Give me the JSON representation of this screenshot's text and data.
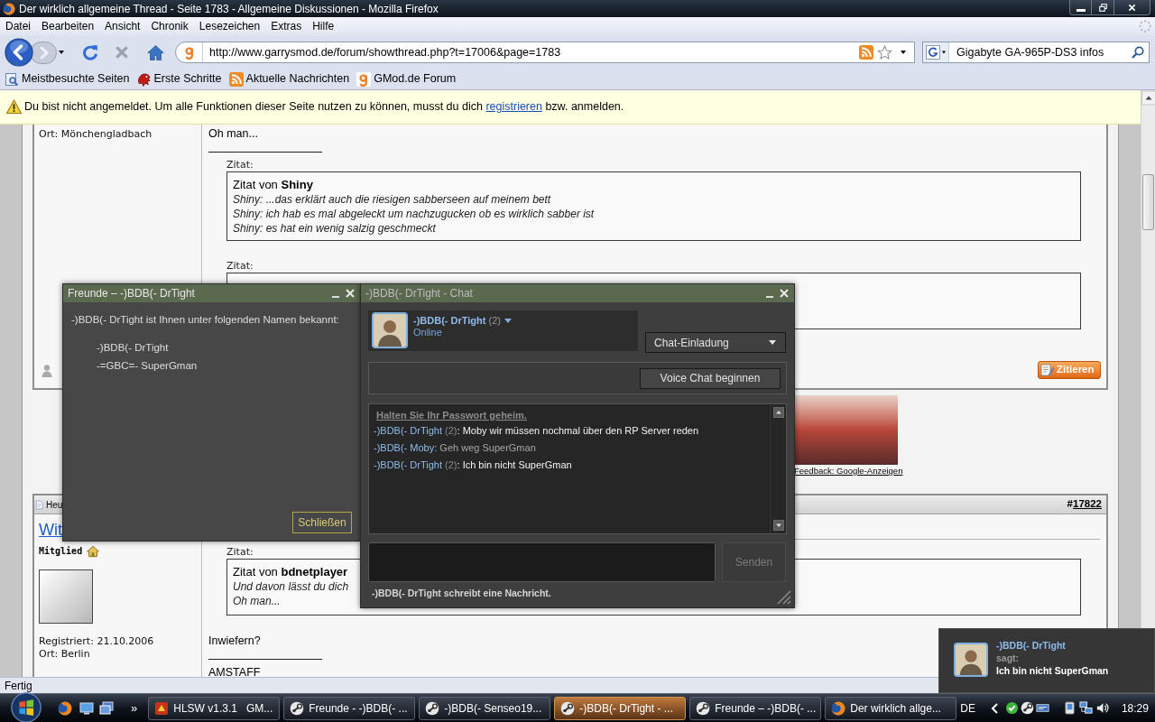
{
  "window": {
    "title": "Der wirklich allgemeine Thread - Seite 1783 - Allgemeine Diskussionen - Mozilla Firefox"
  },
  "menu": [
    "Datei",
    "Bearbeiten",
    "Ansicht",
    "Chronik",
    "Lesezeichen",
    "Extras",
    "Hilfe"
  ],
  "nav_buttons": [
    {
      "kind": "back",
      "disabled": false
    },
    {
      "kind": "forward",
      "disabled": true
    },
    {
      "kind": "reload",
      "disabled": false
    },
    {
      "kind": "stop",
      "disabled": true
    },
    {
      "kind": "home",
      "disabled": false
    }
  ],
  "address_bar": {
    "url": "http://www.garrysmod.de/forum/showthread.php?t=17006&page=1783"
  },
  "search_bar": {
    "value": "Gigabyte GA-965P-DS3 infos"
  },
  "bookmarks": [
    {
      "kind": "smart",
      "label": "Meistbesuchte Seiten"
    },
    {
      "kind": "page",
      "label": "Erste Schritte"
    },
    {
      "kind": "feed",
      "label": "Aktuelle Nachrichten"
    },
    {
      "kind": "site",
      "label": "GMod.de Forum"
    }
  ],
  "notice": {
    "text": "Du bist nicht angemeldet. Um alle Funktionen dieser Seite nutzen zu können, musst du dich",
    "link": "registrieren",
    "text_after": "bzw. anmelden."
  },
  "content": [
    {
      "kind": "post",
      "user_info": [
        "Ort: Mönchengladbach"
      ],
      "body": [
        {
          "kind": "text",
          "text": "Oh man..."
        }
      ],
      "signature": [
        {
          "kind": "quote",
          "label": "Zitat:",
          "author": "Zitat von **Shiny**",
          "lines": [
            "Shiny: ...das erklärt auch die riesigen sabberseen auf meinem bett",
            "Shiny: ich hab es mal abgeleckt um nachzugucken ob es wirklich sabber ist",
            "Shiny: es hat ein wenig salzig geschmeckt"
          ]
        },
        {
          "kind": "quote",
          "label": "Zitat:"
        }
      ],
      "online": false,
      "quote_button": "Zitieren"
    },
    {
      "kind": "ad",
      "feedback": "Feedback: Google-Anzeigen"
    },
    {
      "kind": "post",
      "header": {
        "title": "Heu",
        "number_prefix": "#",
        "number": "17822"
      },
      "username": "Wit",
      "rank": "Mitglied",
      "user_info": [
        "Registriert: 21.10.2006",
        "Ort: Berlin"
      ],
      "body": [
        {
          "kind": "quote",
          "label": "Zitat:",
          "author": "Zitat von **bdnetplayer**",
          "lines": [
            "Und davon lässt du dich",
            "Oh man..."
          ]
        },
        {
          "kind": "text",
          "text": "Inwiefern?"
        }
      ],
      "signature": [
        {
          "kind": "text",
          "text": "AMSTAFF"
        }
      ]
    }
  ],
  "status_bar": {
    "text": "Fertig"
  },
  "friends_window": {
    "title": "Freunde – -)BDB(- DrTight",
    "intro": "-)BDB(- DrTight ist Ihnen unter folgenden Namen bekannt:",
    "names": [
      "-)BDB(- DrTight",
      "-=GBC=- SuperGman"
    ],
    "close_button": "Schließen"
  },
  "chat_window": {
    "title": "-)BDB(- DrTight - Chat",
    "contact": {
      "name": "-)BDB(- DrTight",
      "count": "(2)",
      "status": "Online"
    },
    "invite_dropdown": "Chat-Einladung",
    "voice_button": "Voice Chat beginnen",
    "warning": "Halten Sie Ihr Passwort geheim.",
    "messages": [
      {
        "kind": "incoming",
        "sender": "-)BDB(- DrTight",
        "count": "(2)",
        "sep": ":",
        "text": "Moby wir müssen nochmal über den RP Server reden"
      },
      {
        "kind": "outgoing",
        "sender": "-)BDB(- Moby",
        "sep": ":",
        "text": "Geh weg SuperGman"
      },
      {
        "kind": "incoming",
        "sender": "-)BDB(- DrTight",
        "count": "(2)",
        "sep": ":",
        "text": "Ich bin nicht SuperGman"
      }
    ],
    "send_button": {
      "label": "Senden",
      "disabled": true
    },
    "typing_status": "-)BDB(- DrTight schreibt eine Nachricht."
  },
  "notification": {
    "sender": "-)BDB(- DrTight",
    "verb": "sagt:",
    "text": "Ich bin nicht SuperGman"
  },
  "taskbar": {
    "overflow": "»",
    "items": [
      {
        "kind": "hlsw",
        "label": "HLSW v1.3.1   GM...",
        "selected": false
      },
      {
        "kind": "steam",
        "label": "Freunde - -)BDB(- ...",
        "selected": false
      },
      {
        "kind": "steam",
        "label": "-)BDB(- Senseo19...",
        "selected": false
      },
      {
        "kind": "steam",
        "label": "-)BDB(- DrTight - ...",
        "selected": true
      },
      {
        "kind": "steam",
        "label": "Freunde – -)BDB(- ...",
        "selected": false
      },
      {
        "kind": "firefox",
        "label": "Der wirklich allge...",
        "selected": false
      }
    ],
    "language": "DE",
    "clock": "18:29"
  }
}
